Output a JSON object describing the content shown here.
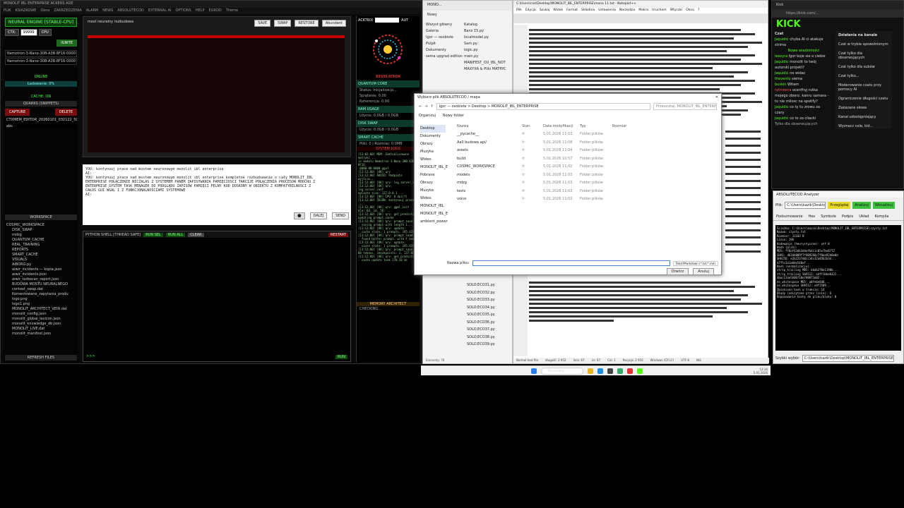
{
  "ide": {
    "title": "MONOLIT IBL ENTERPRISE ACKERS ADE",
    "menu": [
      "PLIK",
      "KSIAZKOWE",
      "Okno",
      "ZAKRZEDZENIA",
      "ALARM",
      "NEWS",
      "ABSOLUTECOD",
      "EXTERNAL AI",
      "OPTIONS",
      "HELP",
      "EUROO",
      "Theme"
    ],
    "engine_title": "NEURAL ENGINE [STABLE-CPU]",
    "ctx_label": "CTX:",
    "ctx_value": "99999",
    "cpu_label": "CPU",
    "ignite": "IGNITE",
    "models": [
      "Nemotron-3-Nano-30B-A3B-8F16-0000",
      "Nemotron-3-Nano-30B-A3B-8F16-0000"
    ],
    "online": "ONLINE",
    "loading": "Ładowanie: 0%",
    "cache_on": "CACHE: ON",
    "quarks": "QUARKS (SNIPPETS)",
    "capture": "CAPTURE",
    "delete": "DELETE",
    "snippet": "CTXMEM_EDITOR_20260101_032122_508",
    "snippet2": "abc",
    "workspace": "WORKSPACE",
    "tree": [
      "COSMIC_WORKSPACE",
      "DISK_SWAP",
      "mdzg",
      "QUANTUM_CACHE",
      "REAL_TRAINING",
      "REPORTS",
      "SMART_CACHE",
      "VISUALS",
      "AIBORG.py",
      "aiwir_incidents — kopia.json",
      "aiwir_incidents.json",
      "aiwir_turbocan_report.json",
      "BUDOWA MOSTU NEURALNEGO",
      "context_swap.dat",
      "Komentowane_zapytania_produ",
      "logo.png",
      "logo1.png",
      "MONOLIT_ARCHITECT_VEIN.dat",
      "monolit_config.json",
      "monolit_global_lexicon.json",
      "monolit_knowledge_db.json",
      "MONOLIT_LIVE.dat",
      "monolit_manifest.json"
    ],
    "refresh": "REFRESH FILES",
    "center_title": "most neuralny rozbudowa",
    "toolbar": [
      "SAVE",
      "SWAP",
      "RESTORE",
      "Abundant"
    ],
    "chat": [
      "YOU: kontynuuj prace nad mostem neuronowym monolit ibl enterprise",
      "AI:",
      "YOU: kontynuuj prace nad mostem neuronowym monolit ibl enterprise kompletne rozbudowanie o cały MONOLIT_IBL",
      "  ENTERPRISE POŁĄCZENIE NICZALAS Z SYSTEMEM PANEM ZAPISYWANIA PAMIĘCIOSCI TARCIJE POŁĄCZENIA PROCESOW MODCRU Z",
      "  ENTERPRISE SYSTEM TASK MENAGER DO PODGLĄDU ZAPISÓW PAMIĘCI PELNY KOD DOSKONY W OBIEKTU Z KOMPATYBILNOSCI Z",
      "  CAŁOS GUI WSAL I Z FUNKCJONALNOŚCIAMI SYSTEMOWE",
      "AI:"
    ],
    "dalej": "DALEJ",
    "send": "SEND",
    "shell_title": "PYTHON SHELL [THREAD SAFE]",
    "run_sel": "RUN SEL",
    "run_all": "RUN ALL",
    "clear": "CLEAR",
    "restart": "RESTART",
    "prompt": ">>>",
    "run": "RUN"
  },
  "mid": {
    "acktrix": "ACKTRIX",
    "aut": "AUT",
    "revelation": "REVELATION",
    "quantum": "QUANTUM CORE",
    "quantum_lines": [
      "Status: Inicjalizacja...",
      "Splątanie: 0.00",
      "Koherencja: 0.00"
    ],
    "ram": "RAM USAGE",
    "ram_val": "Użycie: 0.0GB / 0.0GB",
    "disk": "DISK SWAP",
    "disk_val": "Użycie: 0.0GB / 0.0GB",
    "cache": "SMART CACHE",
    "cache_val": "Pliki: 0 | Rozmiar: 0.0MB",
    "syslogs": "SYSTEM LOGS",
    "log": [
      "[13:02:00] MEM: Zaktualizowano metryki ...",
      "in modelu Nemotron-3-Nano-30B-A3B-8F16",
      "-0000-00-0000.gguf",
      "[13:12:00] [OK] qrv",
      "[13:12:00] AUDIO: Podpięto wyjście...",
      "[13:12:00] [OK] qrv: log_server_r",
      "[13:12:00] [OK] qrv: log_server.conf",
      "opCache size: 127.0.0.1 ...",
      "[13:12:00] [OK] CPU: 0 dpi(f)",
      "[13:12:00] ZEGON: kontynuuj prace ...",
      "[13:12:00] [OK] qrv: ggml_init",
      "dla: 04, 1d, 56: ...",
      "[13:12:00] [OK] qrv: get_prediction",
      "updating prompt cache",
      "[13:12:00] [OK] qrv:   prompt_save:",
      "  - saving prompt with length 1...",
      "[13:12:00] [OK] qrv:   update:",
      "  - cache state: 1 prompts, 195.423",
      "[13:12:00] [OK] qrv:   prompt_load:",
      "  - found better prompt, with f_keep",
      "[13:12:00] [OK] qrv:   update:",
      "  - cache state: 1 prompts, 195.423",
      "[13:12:00] [OK] qrv:   prompt_save:",
      "00 tokens, checkpoints: 1, 137.055",
      "[13:12:00] [OK] qrv: get_prediction",
      "  - cache update took 270.10 ms"
    ],
    "memory": "MEMORY ARCHITECT",
    "memory_val": "CHECKING..."
  },
  "explorer": {
    "title": "MONO...",
    "new": "Nowy",
    "items": [
      "Wszyst główny",
      "Galeria",
      "Igor — osobiste",
      "Pulpit",
      "Dokumenty",
      "Obrazy",
      "Muzyka",
      "Wideo",
      "Monolit_IBL",
      "sema upgrad edition"
    ],
    "files": [
      "Katalog",
      "Banz 15.py",
      "localmodel.py",
      "Sam.py",
      "logic.py",
      "main.py",
      "MANIFEST_OU_IBL_NOT",
      "MAXYXA & Pliki MATRYC"
    ],
    "bottom_files": [
      "SOLO.ECO31.py",
      "SOLO.ECO32.py",
      "SOLO.ECO33.py",
      "SOLO.ECO34.py",
      "SOLO.ECO35.py",
      "SOLO.ECO36.py",
      "SOLO.ECO37.py",
      "SOLO.ECO38.py",
      "SOLO.ECO39.py"
    ],
    "status": "Elementy: 78"
  },
  "notepad": {
    "title": "C:\\Users\\cez\\Desktop\\MONOLIT_IBL_ENTERPRISE\\mono 11.txt - Notepad++",
    "menu": [
      "Plik",
      "Edycja",
      "Szukaj",
      "Widok",
      "Format",
      "Składnia",
      "Ustawienia",
      "Narzędzia",
      "Makra",
      "Uruchom",
      "Wtyczki",
      "Okno",
      "?"
    ],
    "status": [
      "Normal text file",
      "długość: 2 952",
      "linie: 67",
      "Ln: 67",
      "Col: 1",
      "Pozycja: 2 956",
      "Windows (CR LF)",
      "UTF-8",
      "INS"
    ]
  },
  "dialog": {
    "title": "Wybierz plik ABSOLUTECOD / mapa",
    "path": "Igor — osobiste  >  Desktop  >  MONOLIT_IBL_ENTERPRISE",
    "search": "Przeszukaj: MONOLIT_IBL_ENTERPRISE",
    "organize": "Organizuj",
    "new_folder": "Nowy folder",
    "columns": [
      "Nazwa",
      "Stan",
      "Data modyfikacji",
      "Typ",
      "Rozmiar"
    ],
    "rows": [
      {
        "name": "__pycache__",
        "date": "5.01.2026 11:03",
        "type": "Folder plików"
      },
      {
        "name": "Aa0 budowa api/",
        "date": "5.01.2026 11:08",
        "type": "Folder plików"
      },
      {
        "name": "assets",
        "date": "5.01.2026 11:04",
        "type": "Folder plików"
      },
      {
        "name": "build",
        "date": "5.01.2026 10:57",
        "type": "Folder plików"
      },
      {
        "name": "COSMIC_WORKSPACE",
        "date": "5.01.2026 11:02",
        "type": "Folder plików"
      },
      {
        "name": "models",
        "date": "5.01.2026 11:03",
        "type": "Folder plików"
      },
      {
        "name": "mdzg",
        "date": "5.01.2026 11:03",
        "type": "Folder plików"
      },
      {
        "name": "tests",
        "date": "5.01.2026 11:03",
        "type": "Folder plików"
      },
      {
        "name": "voice",
        "date": "5.01.2026 11:03",
        "type": "Folder plików"
      }
    ],
    "nav": [
      "Desktop",
      "Dokumenty",
      "Obrazy",
      "Muzyka",
      "Wideo",
      "MONOLIT_IBL_E",
      "Pobrane",
      "Obrazy",
      "Muzyka",
      "Wideo",
      "MONOLIT_IBL",
      "MONOLIT_IBL_E",
      "ambient_power"
    ],
    "filename_label": "Nazwa pliku:",
    "filter": "Tekst/Markdown (*.txt;*.md)",
    "open": "Otwórz",
    "cancel": "Anuluj"
  },
  "browser": {
    "tab": "Kick",
    "url": "https://kick.com/...",
    "logo": "KICK",
    "chat_title": "Czat",
    "actions_title": "Działania na kanale",
    "chat": [
      {
        "user": "Jaquidic",
        "text": "chyba AI ci atakuje"
      },
      {
        "user": "",
        "text": "strima"
      },
      {
        "user": "",
        "text": "Nowe wiadomości"
      },
      {
        "user": "leesyra",
        "text": "Igor boje sie o ciebie"
      },
      {
        "user": "Jaquidic",
        "text": "monolit to twój"
      },
      {
        "user": "",
        "text": "autorski projekt?"
      },
      {
        "user": "Jaquidic",
        "text": "no widac"
      },
      {
        "user": "thevento",
        "text": "siema"
      },
      {
        "user": "buskin",
        "text": "Witam"
      },
      {
        "user": "rytmierra",
        "text": "ocenfhyj rutka"
      },
      {
        "user": "",
        "text": "mojego zbierz. kanru samara -"
      },
      {
        "user": "",
        "text": "to nie milosc na spotify?"
      },
      {
        "user": "Jaquidic",
        "text": "co ty tu zrowu za"
      },
      {
        "user": "",
        "text": "czary"
      },
      {
        "user": "Jaquidic",
        "text": "co to za cliacki"
      }
    ],
    "actions": [
      "Czat w trybie spowolnionym",
      "Czat tylko dla obserwujących",
      "Czat tylko dla subów",
      "Czat tylko...",
      "Moderowanie czatu przy pomocy AI",
      "Ograniczenie długości czatu",
      "Zakazane słowa",
      "Kanał udostępniający",
      "Wyznacz cele, kid..."
    ],
    "followers_only": "Tylko dla obserwujących"
  },
  "analyzer": {
    "title": "ABSOLUTECOD Analyzer",
    "file_label": "Plik:",
    "file_value": "C:\\Users\\kazik\\Desktop\\",
    "btns": [
      "Przeglądaj",
      "Analizuj",
      "Wizualizuj"
    ],
    "tabs": [
      "Podsumowanie",
      "Hex",
      "Symbole",
      "Podpis",
      "Układ",
      "Kompila"
    ],
    "output": [
      "Ścieżka: C:\\Users\\kazik\\Desktop\\MONOLIT_IBL_ENTERPRISE\\czysty.txt",
      "Nazwa: czysty.txt",
      "Rozmiar: 31103 B",
      "Linie: 196",
      "Kodowanie (heurystyczne): utf-8",
      "",
      "Hash (plik):",
      "MD5:    ff8cf63db3d4ef6dc1c05e7be8772",
      "SHA1:   d634b009f7f809260c7f8ea92b0e0d",
      "SHA256: e2b2237d0cc34c32a85b2b34...",
      "  a7f5c3a1a6be548ef...",
      "",
      "Hash (normalizacja):",
      "strip_trailing MD5:    b6db2f8e1198b...",
      "strip_trailing SHA512: a4ff1bbe6422...",
      "  4bec11ae5b06f10e708073a02...",
      "no_whitespace MD5:     a8fe6e8d8...",
      "no_whitespace SHA512:  e4f2509...",
      "",
      "Zmieniono hash w trakcie: 14",
      "Błędy (odczytane przez linie): 6",
      "Dopasowanie hashy do pliku/bloku: 0"
    ],
    "bottom_label": "Szybki wybór:",
    "bottom_value": "C:\\Users\\kazik\\Desktop\\MONOLIT_IBL_ENTERPRISE"
  },
  "taskbar": {
    "search": "Wyszukaj",
    "time": "13:14",
    "date": "5.01.2026"
  }
}
